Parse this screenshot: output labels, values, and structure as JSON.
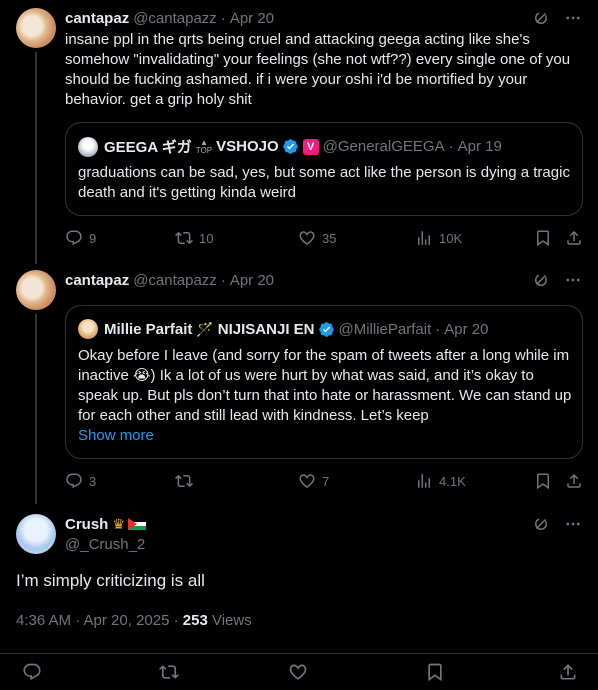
{
  "tweet1": {
    "name": "cantapaz",
    "handle": "@cantapazz",
    "date": "Apr 20",
    "text": "insane ppl in the qrts being cruel and attacking geega acting like she's somehow \"invalidating\" your feelings (she not wtf??) every single one of you should be fucking ashamed. if i were your oshi i'd be mortified by your behavior. get a grip holy shit",
    "quote": {
      "name": "GEEGA ギガ",
      "name2": "VSHOJO",
      "top_badge": "TOP",
      "v_badge": "V",
      "handle": "@GeneralGEEGA",
      "date": "Apr 19",
      "text": "graduations can be sad, yes, but some act like the person is dying a tragic death and it's getting kinda weird"
    },
    "replies": "9",
    "reposts": "10",
    "likes": "35",
    "views": "10K"
  },
  "tweet2": {
    "name": "cantapaz",
    "handle": "@cantapazz",
    "date": "Apr 20",
    "quote": {
      "name": "Millie Parfait",
      "name2": "NIJISANJI EN",
      "handle": "@MillieParfait",
      "date": "Apr 20",
      "text": "Okay before I leave (and sorry for the spam of tweets after a long while im inactive 😭) Ik a lot of us were hurt by what was said, and it’s okay to speak up. But pls don’t turn that into hate or harassment. We can stand up for each other and still lead with kindness. Let’s keep",
      "show_more": "Show more"
    },
    "replies": "3",
    "reposts": "",
    "likes": "7",
    "views": "4.1K"
  },
  "main": {
    "name": "Crush",
    "handle": "@_Crush_2",
    "text": "I’m simply criticizing is all",
    "time": "4:36 AM · Apr 20, 2025",
    "views_count": "253",
    "views_label": "Views"
  },
  "colors": {
    "accent": "#1d9bf0",
    "muted": "#71767b",
    "border": "#2f3336",
    "background": "#000000"
  },
  "icons": [
    "grok-icon",
    "more-icon",
    "reply-icon",
    "repost-icon",
    "like-icon",
    "views-icon",
    "bookmark-icon",
    "share-icon",
    "verified-icon"
  ]
}
